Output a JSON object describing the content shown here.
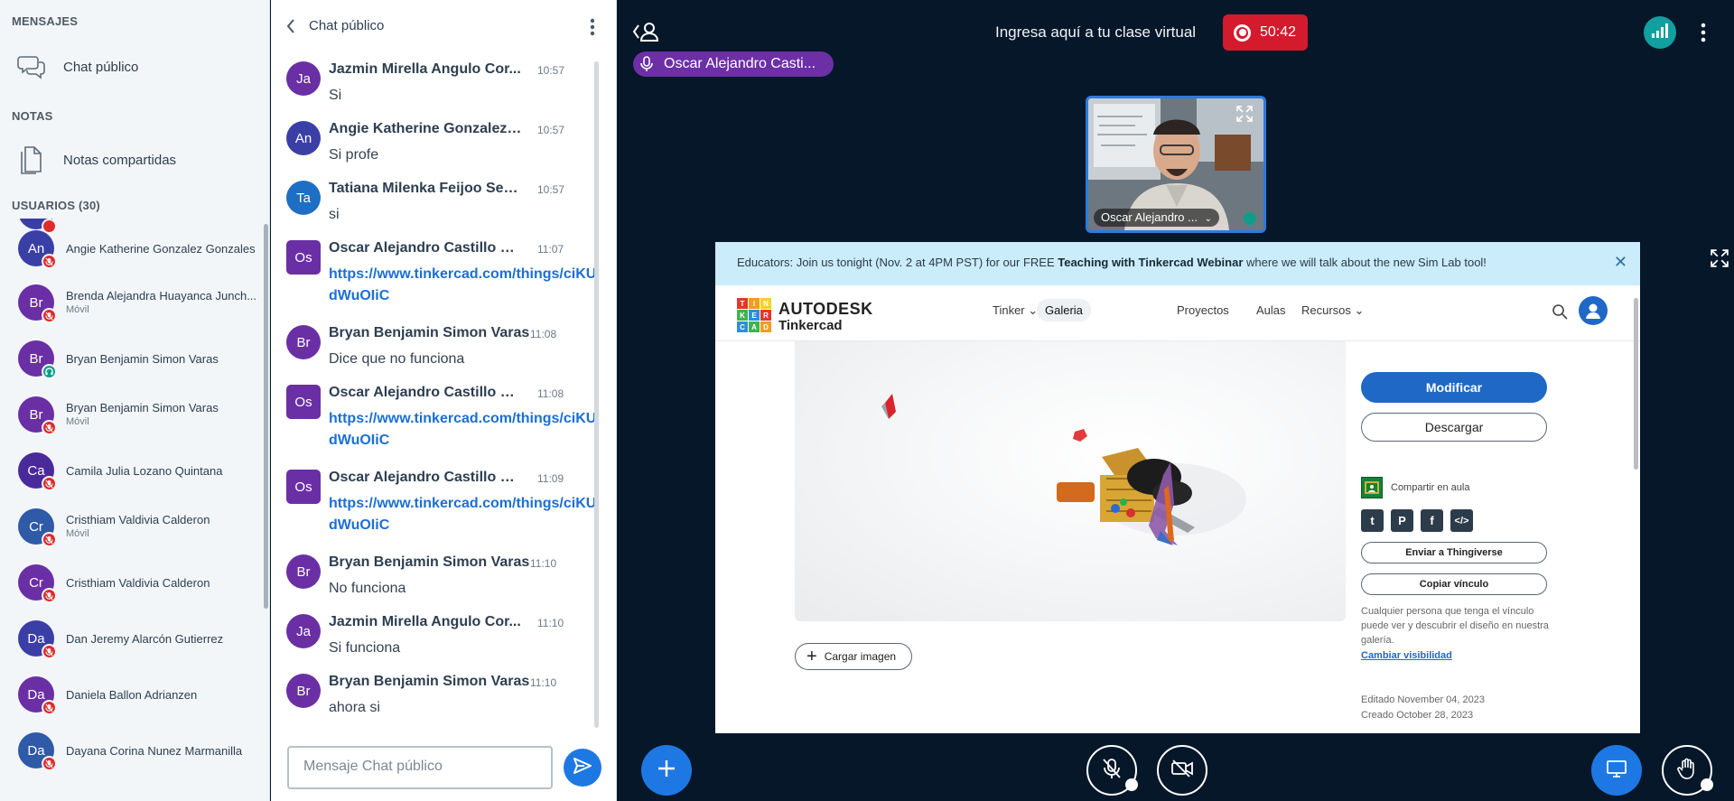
{
  "sidebar": {
    "messages_title": "MENSAJES",
    "public_chat": "Chat público",
    "notes_title": "NOTAS",
    "shared_notes": "Notas compartidas",
    "users_title": "USUARIOS (30)",
    "users": [
      {
        "initials": "An",
        "name": "Angie Katherine Gonzalez Gonzales",
        "sub": "",
        "badge": "muted"
      },
      {
        "initials": "Br",
        "name": "Brenda Alejandra Huayanca Junch...",
        "sub": "Móvil",
        "badge": "muted"
      },
      {
        "initials": "Br",
        "name": "Bryan Benjamin Simon Varas",
        "sub": "",
        "badge": "listen"
      },
      {
        "initials": "Br",
        "name": "Bryan Benjamin Simon Varas",
        "sub": "Móvil",
        "badge": "muted"
      },
      {
        "initials": "Ca",
        "name": "Camila Julia Lozano Quintana",
        "sub": "",
        "badge": "muted"
      },
      {
        "initials": "Cr",
        "name": "Cristhiam Valdivia Calderon",
        "sub": "Móvil",
        "badge": "muted"
      },
      {
        "initials": "Cr",
        "name": "Cristhiam Valdivia Calderon",
        "sub": "",
        "badge": "muted"
      },
      {
        "initials": "Da",
        "name": "Dan Jeremy Alarcón Gutierrez",
        "sub": "",
        "badge": "muted"
      },
      {
        "initials": "Da",
        "name": "Daniela Ballon Adrianzen",
        "sub": "",
        "badge": "muted"
      },
      {
        "initials": "Da",
        "name": "Dayana Corina Nunez Marmanilla",
        "sub": "",
        "badge": "muted"
      }
    ]
  },
  "chat": {
    "title": "Chat público",
    "placeholder": "Mensaje Chat público",
    "messages": [
      {
        "initials": "Ja",
        "name": "Jazmin Mirella Angulo Cor...",
        "time": "10:57",
        "text": "Si",
        "link": "",
        "moderator": false
      },
      {
        "initials": "An",
        "name": "Angie Katherine Gonzalez ...",
        "time": "10:57",
        "text": "Si profe",
        "link": "",
        "moderator": false
      },
      {
        "initials": "Ta",
        "name": "Tatiana Milenka Feijoo Sen...",
        "time": "10:57",
        "text": "si",
        "link": "",
        "moderator": false
      },
      {
        "initials": "Os",
        "name": "Oscar Alejandro Castillo Na...",
        "time": "11:07",
        "text": "",
        "link": "https://www.tinkercad.com/things/ciKUdWuOIiC",
        "moderator": true
      },
      {
        "initials": "Br",
        "name": "Bryan Benjamin Simon Varas",
        "time": "11:08",
        "text": "Dice que no funciona",
        "link": "",
        "moderator": false
      },
      {
        "initials": "Os",
        "name": "Oscar Alejandro Castillo Na...",
        "time": "11:08",
        "text": "",
        "link": "https://www.tinkercad.com/things/ciKUdWuOIiC",
        "moderator": true
      },
      {
        "initials": "Os",
        "name": "Oscar Alejandro Castillo Na...",
        "time": "11:09",
        "text": "",
        "link": "https://www.tinkercad.com/things/ciKUdWuOIiC",
        "moderator": true
      },
      {
        "initials": "Br",
        "name": "Bryan Benjamin Simon Varas",
        "time": "11:10",
        "text": "No funciona",
        "link": "",
        "moderator": false
      },
      {
        "initials": "Ja",
        "name": "Jazmin Mirella Angulo Cor...",
        "time": "11:10",
        "text": "Si funciona",
        "link": "",
        "moderator": false
      },
      {
        "initials": "Br",
        "name": "Bryan Benjamin Simon Varas",
        "time": "11:10",
        "text": "ahora si",
        "link": "",
        "moderator": false
      }
    ]
  },
  "main": {
    "title": "Ingresa aquí a tu clase virtual",
    "recording_time": "50:42",
    "talker": "Oscar Alejandro Casti...",
    "webcam_name": "Oscar Alejandro ..."
  },
  "screenshare": {
    "banner_pre": "Educators: Join us tonight (Nov. 2 at 4PM PST) for our FREE ",
    "banner_bold": "Teaching with Tinkercad Webinar",
    "banner_post": " where we will talk about the new Sim Lab tool!",
    "banner_close": "✕",
    "logo_letters": [
      "T",
      "I",
      "N",
      "K",
      "E",
      "R",
      "C",
      "A",
      "D"
    ],
    "brand1": "AUTODESK",
    "brand2": "Tinkercad",
    "nav": [
      "Tinker",
      "Galeria",
      "Proyectos",
      "Aulas",
      "Recursos"
    ],
    "upload": "Cargar imagen",
    "modify": "Modificar",
    "download": "Descargar",
    "share_class": "Compartir en aula",
    "send_thingiverse": "Enviar a Thingiverse",
    "copy_link": "Copiar vínculo",
    "visibility_note": "Cualquier persona que tenga el vínculo puede ver y descubrir el diseño en nuestra galería.",
    "change_visibility": "Cambiar visibilidad",
    "edited": "Editado November 04, 2023",
    "created": "Creado October 28, 2023"
  },
  "colors": {
    "avatar_purple": "#6a2fa5",
    "avatar_blue": "#2f5aa8",
    "avatar_indigo": "#3a3fa6",
    "muted_red": "#e02c2c",
    "listen_teal": "#0f9d8a",
    "accent_blue": "#1e78e4"
  }
}
